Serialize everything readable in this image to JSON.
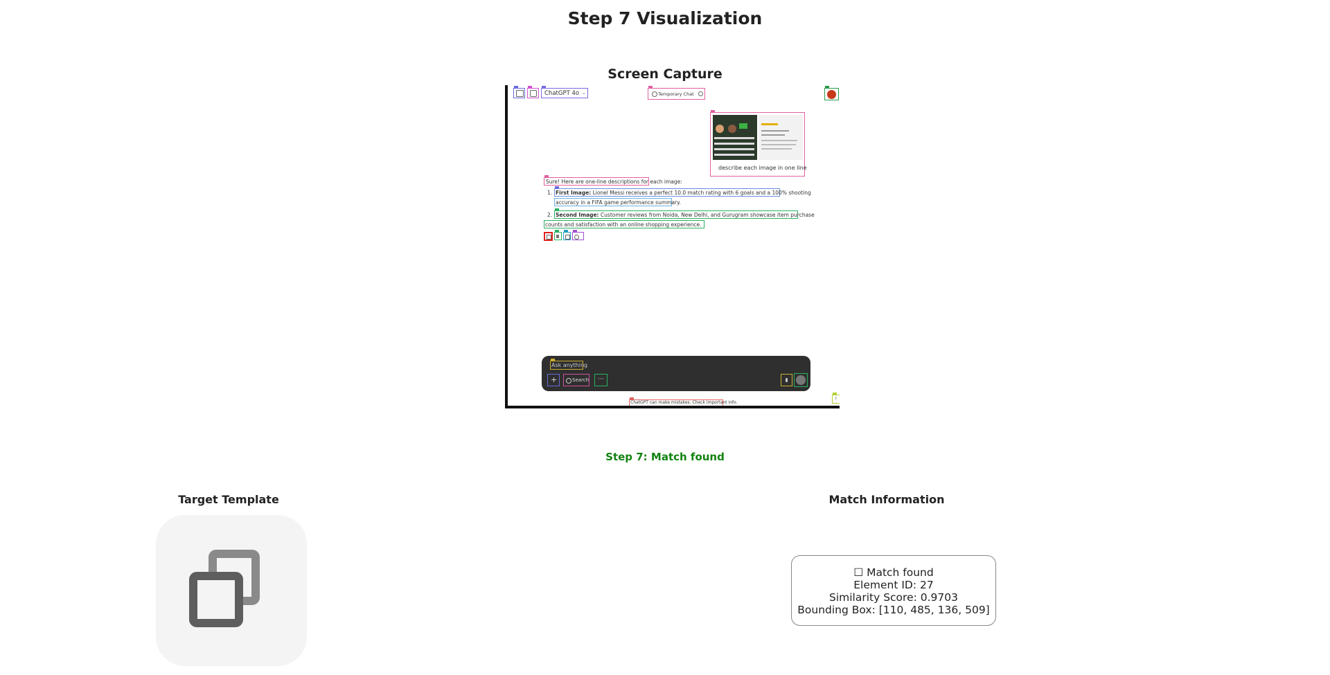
{
  "page": {
    "title": "Step 7 Visualization",
    "capture_title": "Screen Capture",
    "status": "Step 7: Match found",
    "template_title": "Target Template",
    "match_title": "Match Information"
  },
  "capture": {
    "model_label": "ChatGPT 4o",
    "temp_chat": "Temporary Chat",
    "image_prompt": "describe each image in one line",
    "intro": "Sure! Here are one-line descriptions for each image:",
    "item1_bold": "First Image:",
    "item1_text": "Lionel Messi receives a perfect 10.0 match rating with 6 goals and a 100% shooting",
    "item1_cont": "accuracy in a FIFA game performance summary.",
    "item2_bold": "Second Image:",
    "item2_text": "Customer reviews from Noida, New Delhi, and Gurugram showcase item purchase",
    "item2_cont": "counts and satisfaction with an online shopping experience.",
    "input_placeholder": "Ask anything",
    "search_label": "Search",
    "disclaimer": "ChatGPT can make mistakes. Check important info."
  },
  "match": {
    "line1": "☐ Match found",
    "line2": "Element ID: 27",
    "line3": "Similarity Score: 0.9703",
    "line4": "Bounding Box: [110, 485, 136, 509]"
  },
  "icons": {
    "template": "copy-icon"
  }
}
